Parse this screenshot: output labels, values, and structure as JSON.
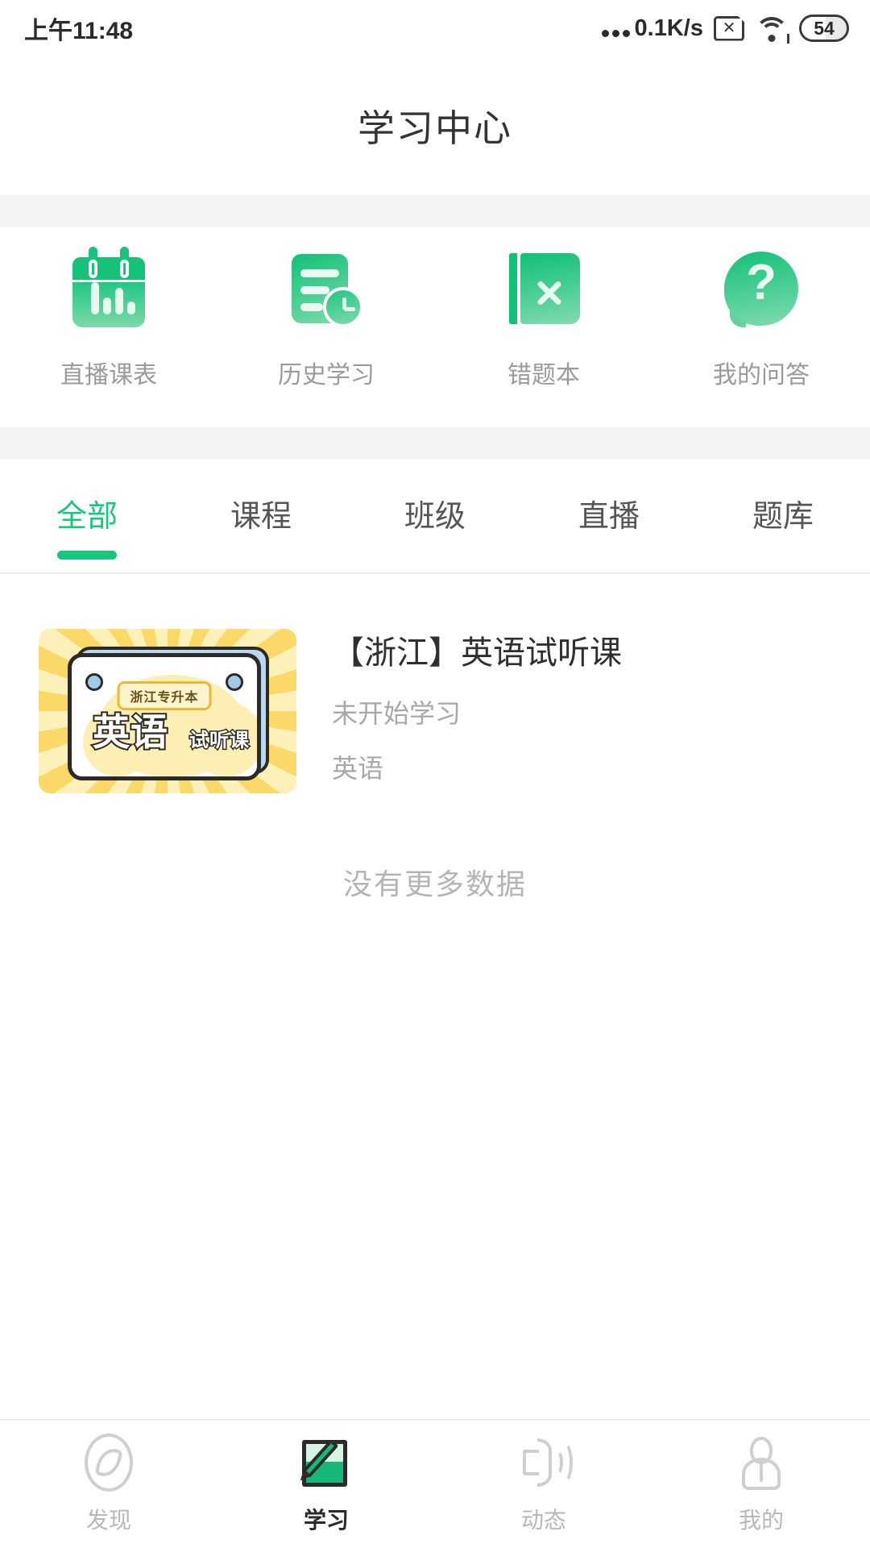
{
  "status_bar": {
    "time": "上午11:48",
    "net_speed": "0.1K/s",
    "sim_icon": "sim-card-disabled-icon",
    "wifi_icon": "wifi-icon",
    "battery_level": "54"
  },
  "header": {
    "title": "学习中心"
  },
  "quick_entries": [
    {
      "label": "直播课表",
      "icon": "calendar-chart-icon"
    },
    {
      "label": "历史学习",
      "icon": "document-clock-icon"
    },
    {
      "label": "错题本",
      "icon": "notebook-cross-icon"
    },
    {
      "label": "我的问答",
      "icon": "question-bubble-icon"
    }
  ],
  "tabs": [
    {
      "label": "全部",
      "active": true
    },
    {
      "label": "课程",
      "active": false
    },
    {
      "label": "班级",
      "active": false
    },
    {
      "label": "直播",
      "active": false
    },
    {
      "label": "题库",
      "active": false
    }
  ],
  "course_list": {
    "items": [
      {
        "title": "【浙江】英语试听课",
        "status": "未开始学习",
        "subject": "英语",
        "thumbnail": {
          "badge": "浙江专升本",
          "main_text": "英语",
          "sub_text": "试听课"
        }
      }
    ],
    "footer": "没有更多数据"
  },
  "bottom_nav": [
    {
      "label": "发现",
      "icon": "compass-icon",
      "active": false
    },
    {
      "label": "学习",
      "icon": "notepad-pen-icon",
      "active": true
    },
    {
      "label": "动态",
      "icon": "speaker-icon",
      "active": false
    },
    {
      "label": "我的",
      "icon": "person-icon",
      "active": false
    }
  ],
  "colors": {
    "accent_green": "#16c87d",
    "band_gray": "#f4f4f4",
    "muted_text": "#a8a8a8"
  }
}
